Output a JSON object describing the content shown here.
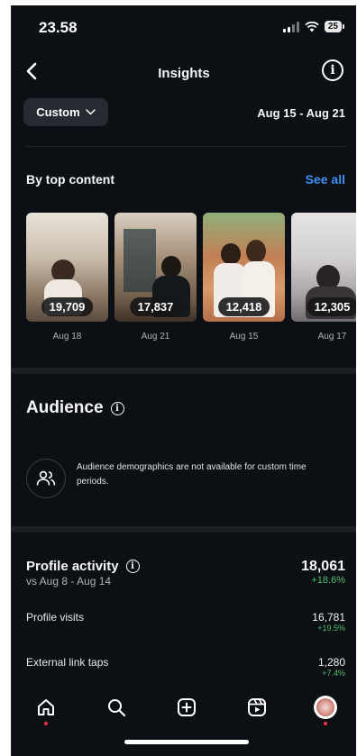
{
  "status_bar": {
    "time": "23.58",
    "battery": "25"
  },
  "header": {
    "title": "Insights"
  },
  "filter": {
    "custom_label": "Custom",
    "date_range": "Aug 15 - Aug 21"
  },
  "top_content": {
    "title": "By top content",
    "see_all": "See all",
    "items": [
      {
        "count": "19,709",
        "date": "Aug 18"
      },
      {
        "count": "17,837",
        "date": "Aug 21"
      },
      {
        "count": "12,418",
        "date": "Aug 15"
      },
      {
        "count": "12,305",
        "date": "Aug 17"
      }
    ]
  },
  "audience": {
    "title": "Audience",
    "message": "Audience demographics are not available for custom time periods."
  },
  "profile_activity": {
    "title": "Profile activity",
    "compare": "vs Aug 8 - Aug 14",
    "total": "18,061",
    "change": "+18.6%",
    "metrics": [
      {
        "label": "Profile visits",
        "value": "16,781",
        "change": "+19.5%"
      },
      {
        "label": "External link taps",
        "value": "1,280",
        "change": "+7.4%"
      }
    ]
  },
  "tabbar": {
    "items": [
      "home",
      "search",
      "create",
      "reels",
      "profile"
    ]
  }
}
